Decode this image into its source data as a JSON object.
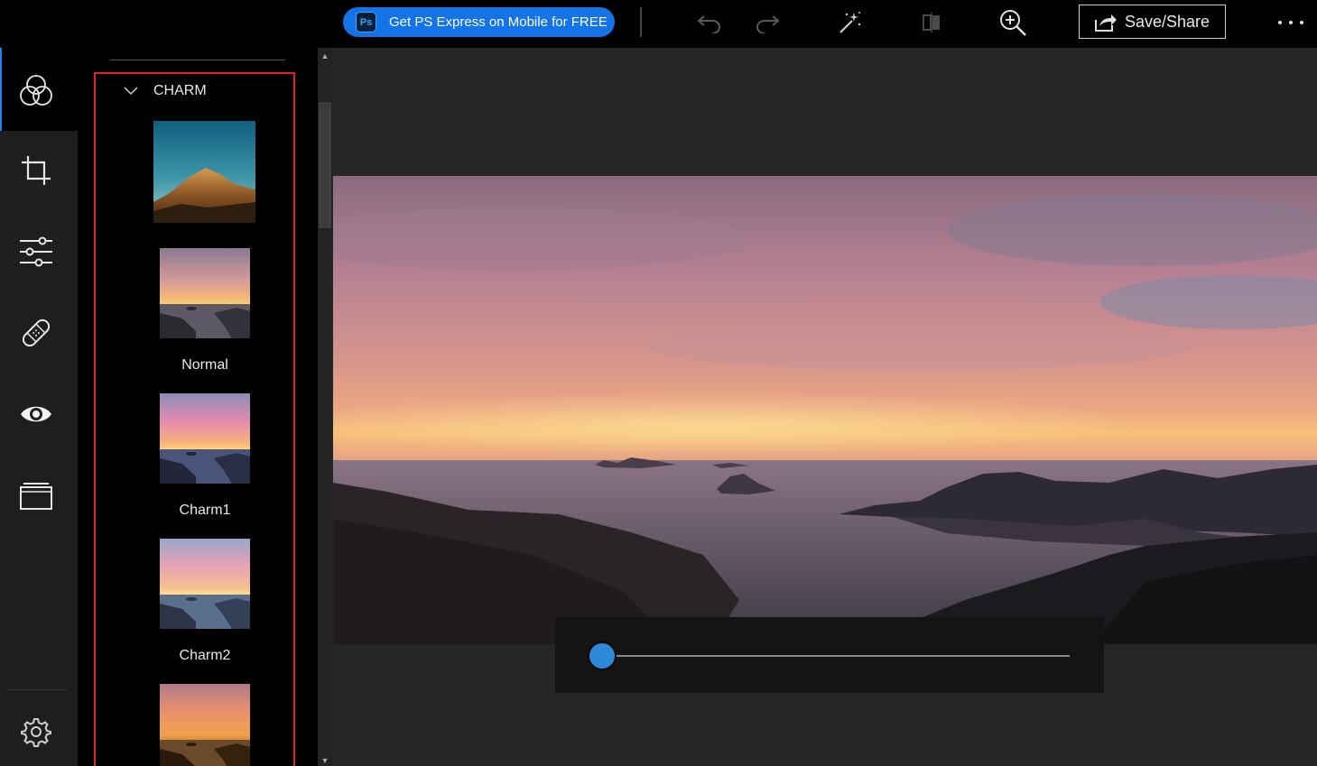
{
  "topbar": {
    "promo_label": "Get PS Express on Mobile for FREE",
    "promo_logo": "Ps",
    "save_label": "Save/Share",
    "icons": [
      "undo-icon",
      "redo-icon",
      "magic-wand-icon",
      "compare-icon",
      "zoom-in-icon",
      "share-icon",
      "more-icon"
    ]
  },
  "rail": {
    "tools": [
      "filters-icon",
      "crop-icon",
      "adjustments-icon",
      "healing-icon",
      "red-eye-icon",
      "borders-icon",
      "settings-icon"
    ]
  },
  "panel": {
    "section_title": "CHARM",
    "items": [
      {
        "label": ""
      },
      {
        "label": "Normal"
      },
      {
        "label": "Charm1"
      },
      {
        "label": "Charm2"
      },
      {
        "label": ""
      }
    ]
  },
  "slider": {
    "value": 0.0
  },
  "colors": {
    "accent": "#2d8ad8",
    "promo": "#1473e6",
    "highlight": "#e0202a"
  }
}
